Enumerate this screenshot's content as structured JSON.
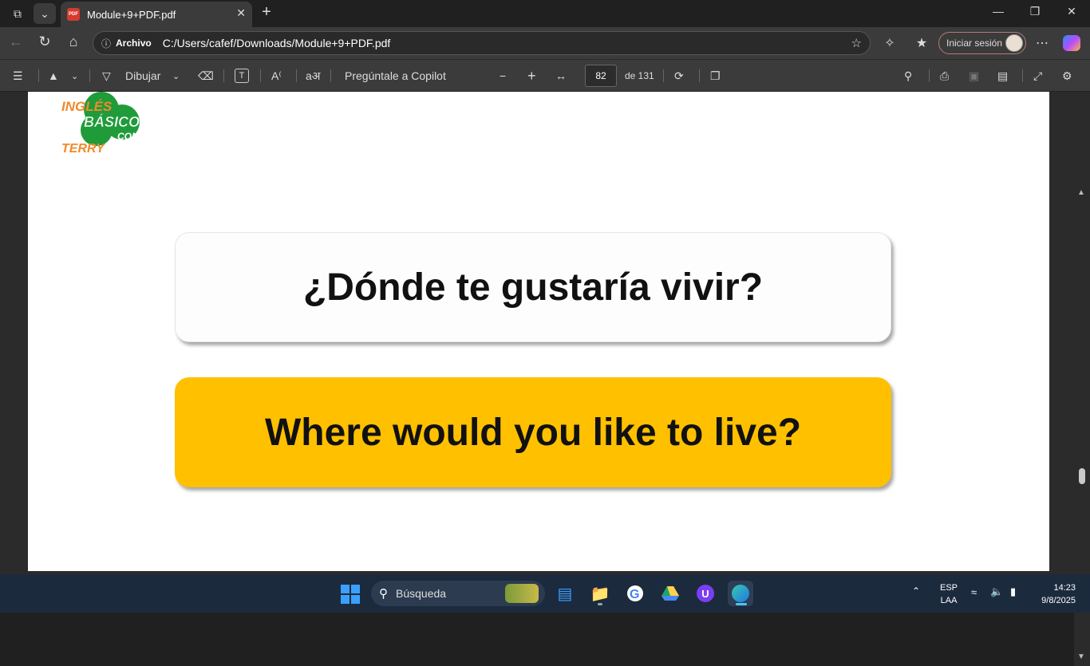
{
  "browser": {
    "tab_title": "Module+9+PDF.pdf",
    "tab_icon_text": "PDF",
    "address": {
      "site_label": "Archivo",
      "path": "C:/Users/cafef/Downloads/Module+9+PDF.pdf"
    },
    "signin_label": "Iniciar sesión"
  },
  "pdf_toolbar": {
    "draw_label": "Dibujar",
    "copilot_label": "Pregúntale a Copilot",
    "page_current": "82",
    "page_total_label": "de 131"
  },
  "document": {
    "logo": {
      "line1": "INGLÉS",
      "line2": "BÁSICO",
      "line3": "CON",
      "line4": "TERRY"
    },
    "question_es": "¿Dónde te gustaría vivir?",
    "question_en": "Where would you like to live?"
  },
  "taskbar": {
    "search_placeholder": "Búsqueda",
    "language_top": "ESP",
    "language_bottom": "LAA",
    "time": "14:23",
    "date": "9/8/2025"
  },
  "colors": {
    "accent_yellow": "#ffc000",
    "logo_green": "#1f9b3a",
    "logo_orange": "#f08a2b"
  }
}
